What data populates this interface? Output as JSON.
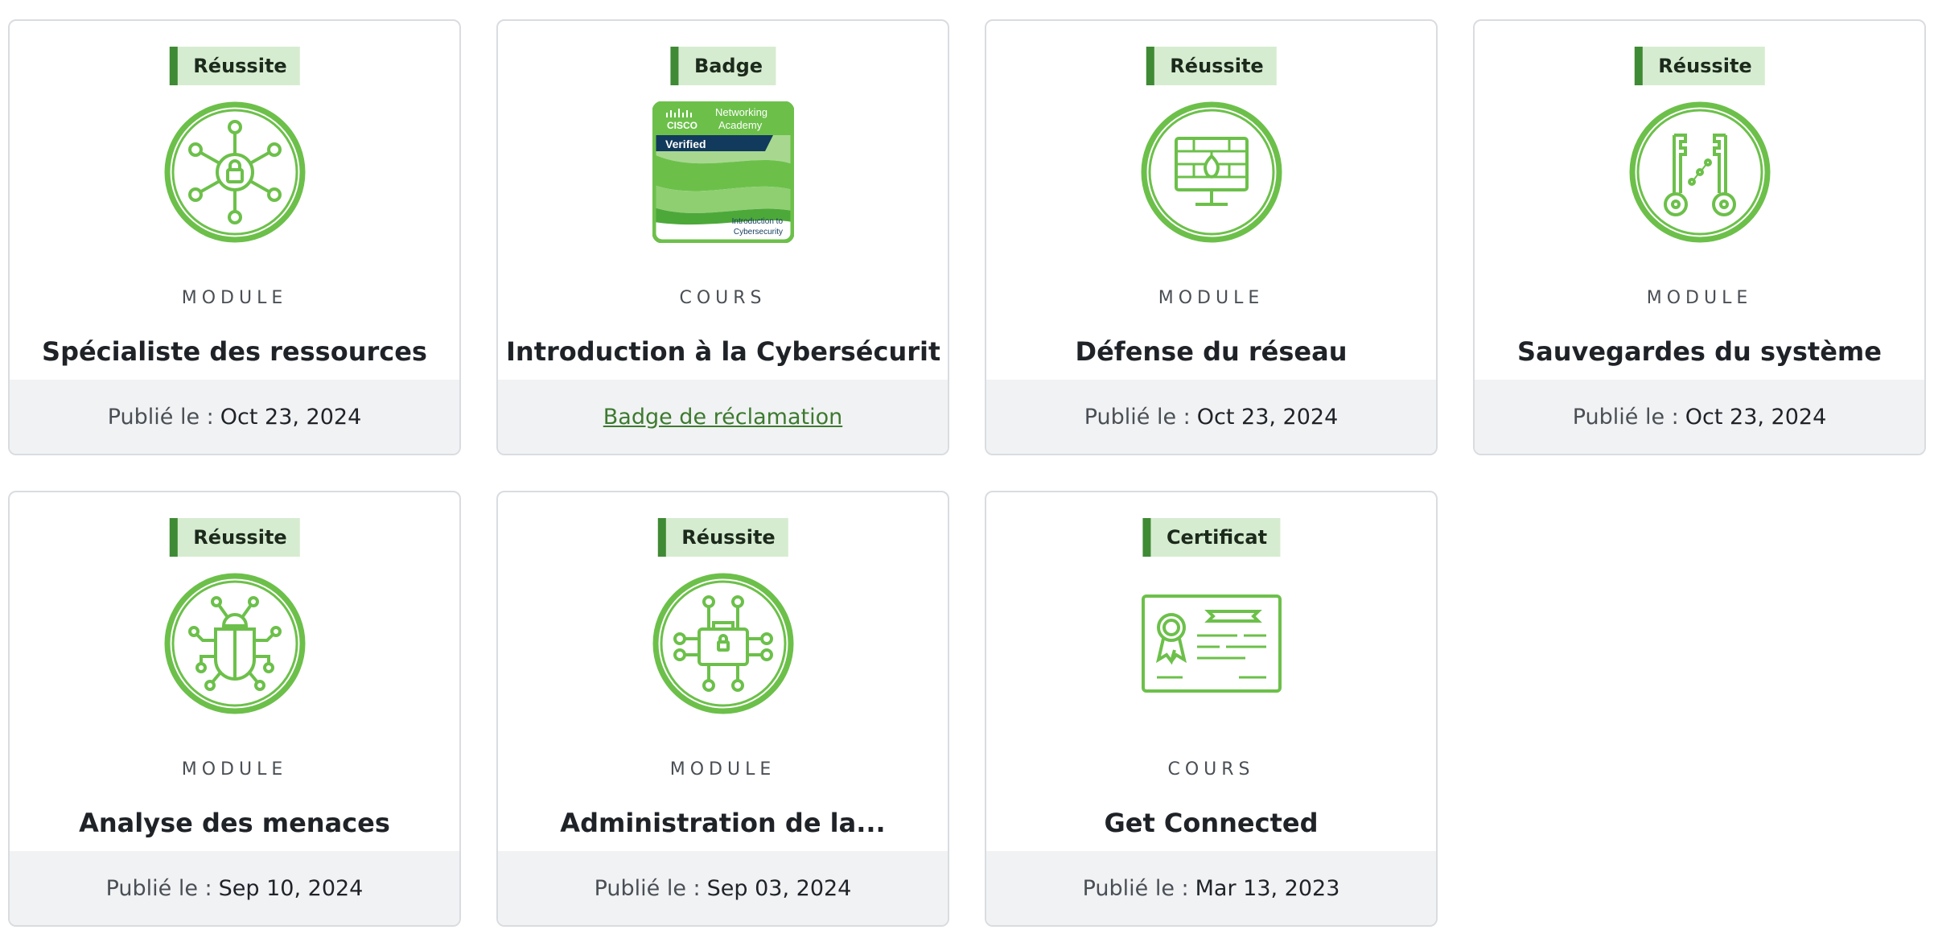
{
  "colors": {
    "accent_green": "#6cc04a",
    "tag_bar": "#3f8a34",
    "tag_bg": "#d6ecd0",
    "link": "#3d7a2f"
  },
  "cards": [
    {
      "tag": "Réussite",
      "icon": "network-lock-icon",
      "type": "MODULE",
      "title": "Spécialiste des ressources",
      "footer_label": "Publié le :",
      "footer_date": "Oct 23, 2024"
    },
    {
      "tag": "Badge",
      "icon": "cisco-badge-icon",
      "type": "COURS",
      "title": "Introduction à la Cybersécurité",
      "footer_link": "Badge de réclamation",
      "badge": {
        "brand_line1": "Networking",
        "brand_line2": "Academy",
        "brand_name": "CISCO",
        "verified": "Verified",
        "course_line1": "Introduction to",
        "course_line2": "Cybersecurity"
      }
    },
    {
      "tag": "Réussite",
      "icon": "monitor-firewall-icon",
      "type": "MODULE",
      "title": "Défense du réseau",
      "footer_label": "Publié le :",
      "footer_date": "Oct 23, 2024"
    },
    {
      "tag": "Réussite",
      "icon": "keys-icon",
      "type": "MODULE",
      "title": "Sauvegardes du système",
      "footer_label": "Publié le :",
      "footer_date": "Oct 23, 2024"
    },
    {
      "tag": "Réussite",
      "icon": "bug-icon",
      "type": "MODULE",
      "title": "Analyse des menaces",
      "footer_label": "Publié le :",
      "footer_date": "Sep 10, 2024"
    },
    {
      "tag": "Réussite",
      "icon": "briefcase-network-icon",
      "type": "MODULE",
      "title": "Administration de la...",
      "footer_label": "Publié le :",
      "footer_date": "Sep 03, 2024"
    },
    {
      "tag": "Certificat",
      "icon": "certificate-icon",
      "type": "COURS",
      "title": "Get Connected",
      "footer_label": "Publié le :",
      "footer_date": "Mar 13, 2023"
    }
  ]
}
